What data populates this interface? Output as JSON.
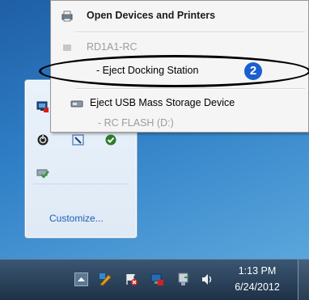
{
  "context_menu": {
    "items": [
      {
        "label": "Open Devices and Printers",
        "style": "bold",
        "icon": "devices-printers-icon"
      },
      {
        "label": "RD1A1-RC",
        "style": "disabled",
        "icon": "docking-device-icon"
      },
      {
        "label": "- Eject Docking Station",
        "style": "normal"
      },
      {
        "label": "Eject USB Mass Storage Device",
        "style": "normal",
        "icon": "usb-drive-icon"
      },
      {
        "label": "- RC FLASH (D:)",
        "style": "disabled"
      }
    ]
  },
  "callout": {
    "badge_number": "2",
    "badge_color": "#1a5fd0"
  },
  "tray_panel": {
    "customize_label": "Customize...",
    "icons": [
      "network-icon",
      "power-icon",
      "pen-tablet-icon",
      "security-check-icon",
      "device-check-icon"
    ]
  },
  "taskbar": {
    "time": "1:13 PM",
    "date": "6/24/2012",
    "icons": [
      "show-hidden-icons-arrow",
      "pen-input-icon",
      "action-center-flag-icon",
      "network-error-icon",
      "safely-remove-hardware-icon",
      "volume-icon"
    ]
  },
  "colors": {
    "link_blue": "#1a5fb4",
    "taskbar_dark": "#1e3147"
  }
}
